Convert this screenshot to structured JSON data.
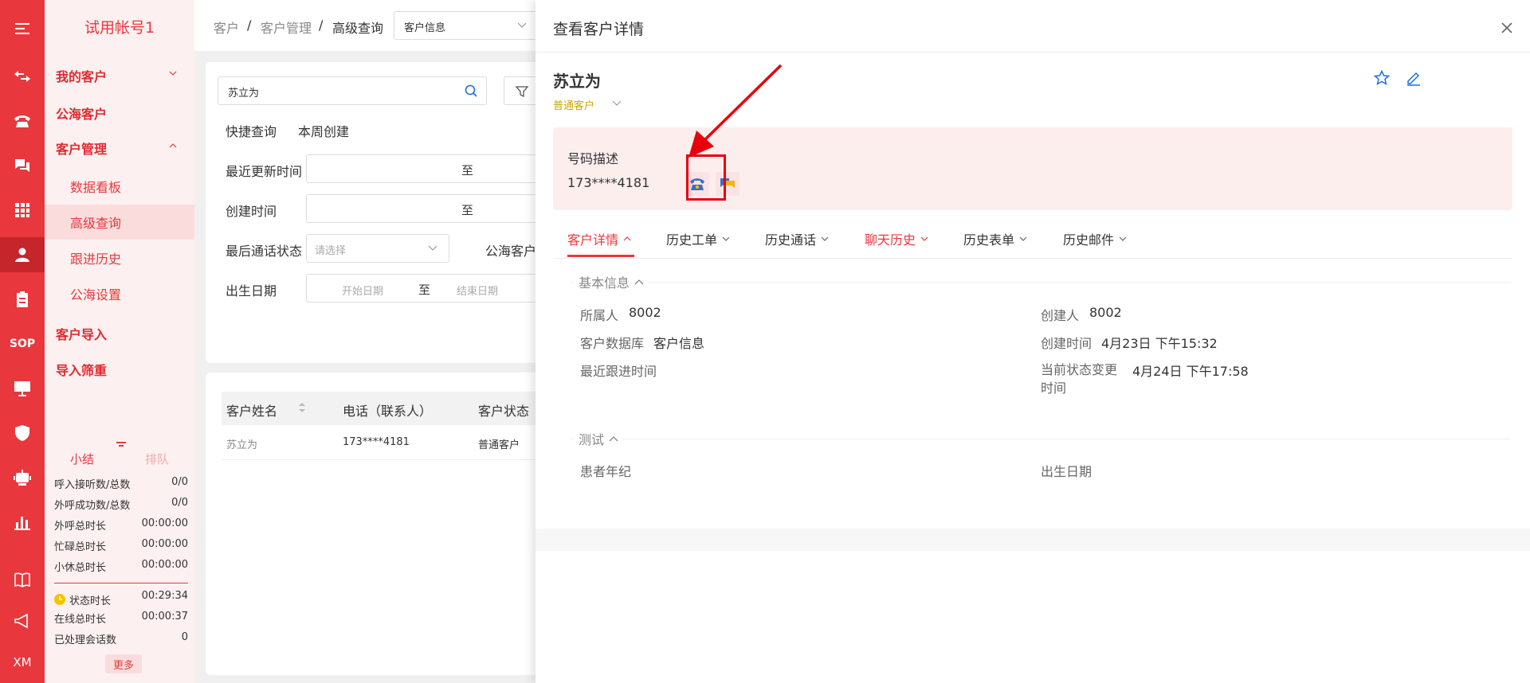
{
  "rail": {
    "sop_label": "SOP",
    "user_label": "XM"
  },
  "sidebar": {
    "account": "试用帐号1",
    "items": [
      {
        "label": "我的客户"
      },
      {
        "label": "公海客户"
      },
      {
        "label": "客户管理"
      },
      {
        "label": "数据看板"
      },
      {
        "label": "高级查询"
      },
      {
        "label": "跟进历史"
      },
      {
        "label": "公海设置"
      },
      {
        "label": "客户导入"
      },
      {
        "label": "导入筛重"
      }
    ],
    "stat_tabs": [
      "小结",
      "排队"
    ],
    "stats": [
      {
        "label": "呼入接听数/总数",
        "value": "0/0"
      },
      {
        "label": "外呼成功数/总数",
        "value": "0/0"
      },
      {
        "label": "外呼总时长",
        "value": "00:00:00"
      },
      {
        "label": "忙碌总时长",
        "value": "00:00:00"
      },
      {
        "label": "小休总时长",
        "value": "00:00:00"
      },
      {
        "label": "状态时长",
        "value": "00:29:34"
      },
      {
        "label": "在线总时长",
        "value": "00:00:37"
      },
      {
        "label": "已处理会话数",
        "value": "0"
      }
    ],
    "more": "更多"
  },
  "breadcrumb": {
    "items": [
      "客户",
      "客户管理",
      "高级查询"
    ],
    "sep": "/",
    "db_select": "客户信息"
  },
  "filter": {
    "search_value": "苏立为",
    "quick_label": "快捷查询",
    "quick_value": "本周创建",
    "updated_label": "最近更新时间",
    "created_label": "创建时间",
    "range_sep": "至",
    "call_status_label": "最后通话状态",
    "call_status_placeholder": "请选择",
    "sea_label": "公海客户",
    "birth_label": "出生日期",
    "start_placeholder": "开始日期",
    "end_placeholder": "结束日期"
  },
  "table": {
    "columns": [
      "客户姓名",
      "电话（联系人）",
      "客户状态"
    ],
    "rows": [
      {
        "name": "苏立为",
        "phone": "173****4181",
        "status": "普通客户"
      }
    ]
  },
  "drawer": {
    "title": "查看客户详情",
    "customer_name": "苏立为",
    "customer_type": "普通客户",
    "phone_desc_label": "号码描述",
    "phone": "173****4181",
    "tabs": [
      "客户详情",
      "历史工单",
      "历史通话",
      "聊天历史",
      "历史表单",
      "历史邮件"
    ],
    "section_basic": "基本信息",
    "fields_left": [
      {
        "label": "所属人",
        "value": "8002"
      },
      {
        "label": "客户数据库",
        "value": "客户信息"
      },
      {
        "label": "最近跟进时间",
        "value": ""
      }
    ],
    "fields_right": [
      {
        "label": "创建人",
        "value": "8002"
      },
      {
        "label": "创建时间",
        "value": "4月23日 下午15:32"
      },
      {
        "label": "当前状态变更时间",
        "value": "4月24日 下午17:58"
      }
    ],
    "section_test": "测试",
    "test_left_label": "患者年纪",
    "test_right_label": "出生日期"
  },
  "colors": {
    "accent": "#e8383d",
    "rail": "#e8383d",
    "menu_bg": "#fdf0f0",
    "phone_panel": "#fdeeee",
    "type_yellow": "#c9a800"
  }
}
